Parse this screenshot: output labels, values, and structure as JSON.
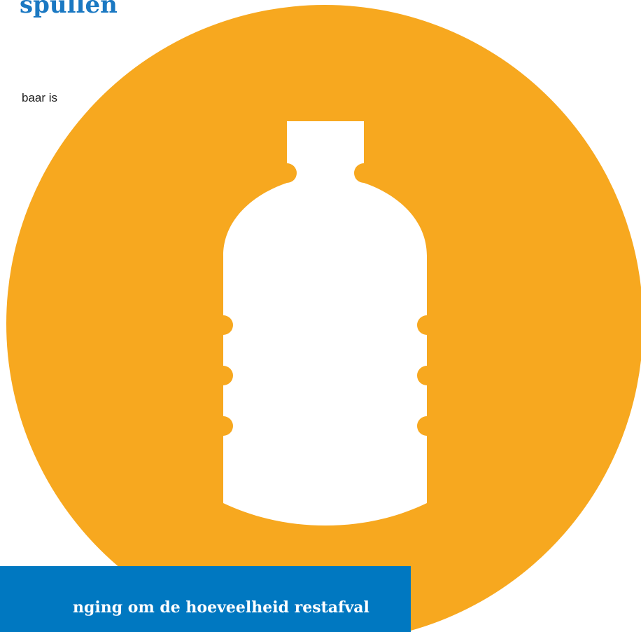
{
  "heading": {
    "text": "spullen"
  },
  "body": {
    "text": "baar is"
  },
  "illustration": {
    "icon": "bottle-icon",
    "circle_color": "#f7a81f",
    "bottle_color": "#ffffff"
  },
  "banner": {
    "text": "nging om de hoeveelheid restafval",
    "background": "#0078c1"
  }
}
